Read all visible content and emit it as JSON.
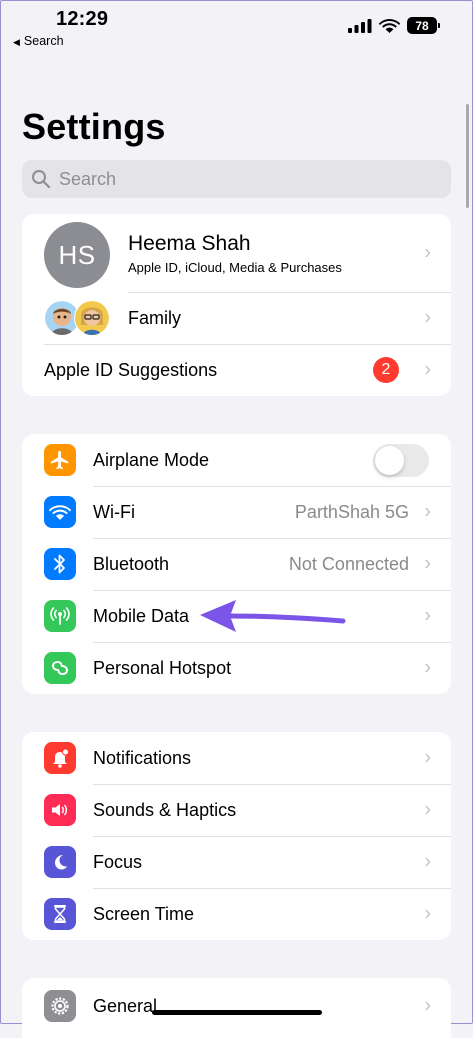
{
  "status_bar": {
    "time": "12:29",
    "back_label": "Search",
    "battery": "78"
  },
  "header": {
    "title": "Settings"
  },
  "search": {
    "placeholder": "Search"
  },
  "account": {
    "initials": "HS",
    "name": "Heema Shah",
    "subtitle": "Apple ID, iCloud, Media & Purchases",
    "family_label": "Family",
    "suggestions_label": "Apple ID Suggestions",
    "suggestions_count": "2"
  },
  "connectivity": {
    "airplane": {
      "label": "Airplane Mode",
      "on": false,
      "color": "#ff9500"
    },
    "wifi": {
      "label": "Wi-Fi",
      "value": "ParthShah 5G",
      "color": "#007aff"
    },
    "bluetooth": {
      "label": "Bluetooth",
      "value": "Not Connected",
      "color": "#007aff"
    },
    "mobile_data": {
      "label": "Mobile Data",
      "color": "#34c759"
    },
    "hotspot": {
      "label": "Personal Hotspot",
      "color": "#34c759"
    }
  },
  "alerts": {
    "notifications": {
      "label": "Notifications",
      "color": "#ff3b30"
    },
    "sounds": {
      "label": "Sounds & Haptics",
      "color": "#ff2d55"
    },
    "focus": {
      "label": "Focus",
      "color": "#5856d6"
    },
    "screen_time": {
      "label": "Screen Time",
      "color": "#5856d6"
    }
  },
  "general": {
    "general": {
      "label": "General",
      "color": "#8e8e93"
    }
  },
  "annotation": {
    "arrow_color": "#7b55e8"
  }
}
